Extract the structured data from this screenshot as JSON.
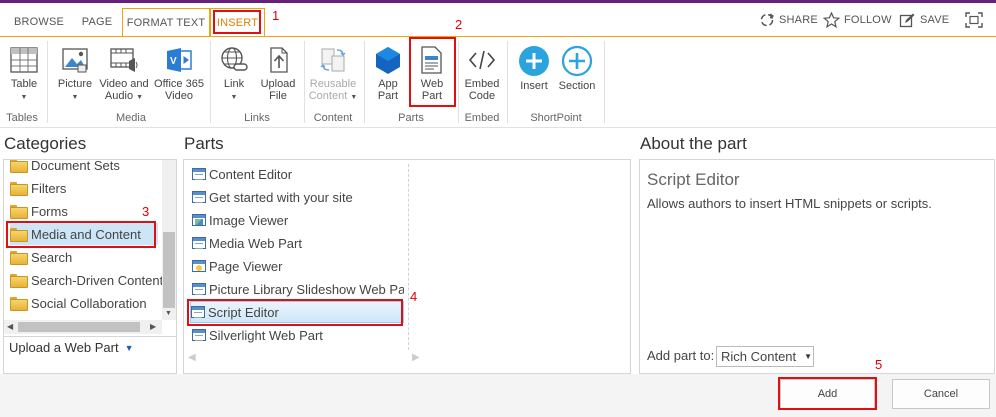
{
  "tabs": [
    {
      "label": "BROWSE"
    },
    {
      "label": "PAGE"
    },
    {
      "label": "FORMAT TEXT"
    },
    {
      "label": "INSERT"
    }
  ],
  "step_markers": [
    "1",
    "2",
    "3",
    "4",
    "5"
  ],
  "commands": {
    "share": "SHARE",
    "follow": "FOLLOW",
    "save": "SAVE"
  },
  "ribbon": {
    "table": {
      "label": "Table",
      "group": "Tables"
    },
    "picture": {
      "label": "Picture"
    },
    "video": {
      "label1": "Video and",
      "label2": "Audio"
    },
    "o365": {
      "label1": "Office 365",
      "label2": "Video"
    },
    "media_group": "Media",
    "link": {
      "label": "Link"
    },
    "upload": {
      "label1": "Upload",
      "label2": "File"
    },
    "links_group": "Links",
    "reusable": {
      "label1": "Reusable",
      "label2": "Content"
    },
    "content_group": "Content",
    "app_part": {
      "label1": "App",
      "label2": "Part"
    },
    "web_part": {
      "label1": "Web",
      "label2": "Part"
    },
    "parts_group": "Parts",
    "embed": {
      "label1": "Embed",
      "label2": "Code",
      "group": "Embed"
    },
    "insert": {
      "label": "Insert"
    },
    "section": {
      "label": "Section"
    },
    "shortpoint_group": "ShortPoint"
  },
  "categories": {
    "title": "Categories",
    "items": [
      {
        "label": "Document Sets"
      },
      {
        "label": "Filters"
      },
      {
        "label": "Forms"
      },
      {
        "label": "Media and Content"
      },
      {
        "label": "Search"
      },
      {
        "label": "Search-Driven Content"
      },
      {
        "label": "Social Collaboration"
      }
    ],
    "selected": "Media and Content",
    "upload_label": "Upload a Web Part"
  },
  "parts": {
    "title": "Parts",
    "items": [
      {
        "label": "Content Editor"
      },
      {
        "label": "Get started with your site"
      },
      {
        "label": "Image Viewer"
      },
      {
        "label": "Media Web Part"
      },
      {
        "label": "Page Viewer"
      },
      {
        "label": "Picture Library Slideshow Web Part"
      },
      {
        "label": "Script Editor"
      },
      {
        "label": "Silverlight Web Part"
      }
    ],
    "selected": "Script Editor"
  },
  "about": {
    "title": "About the part",
    "part_name": "Script Editor",
    "description": "Allows authors to insert HTML snippets or scripts.",
    "add_to_label": "Add part to:",
    "add_to_value": "Rich Content"
  },
  "actions": {
    "add": "Add",
    "cancel": "Cancel"
  },
  "colors": {
    "accent": "#f0a30a",
    "suite_bar": "#68217a",
    "highlight": "#d11111",
    "selection": "#cde6f7"
  }
}
